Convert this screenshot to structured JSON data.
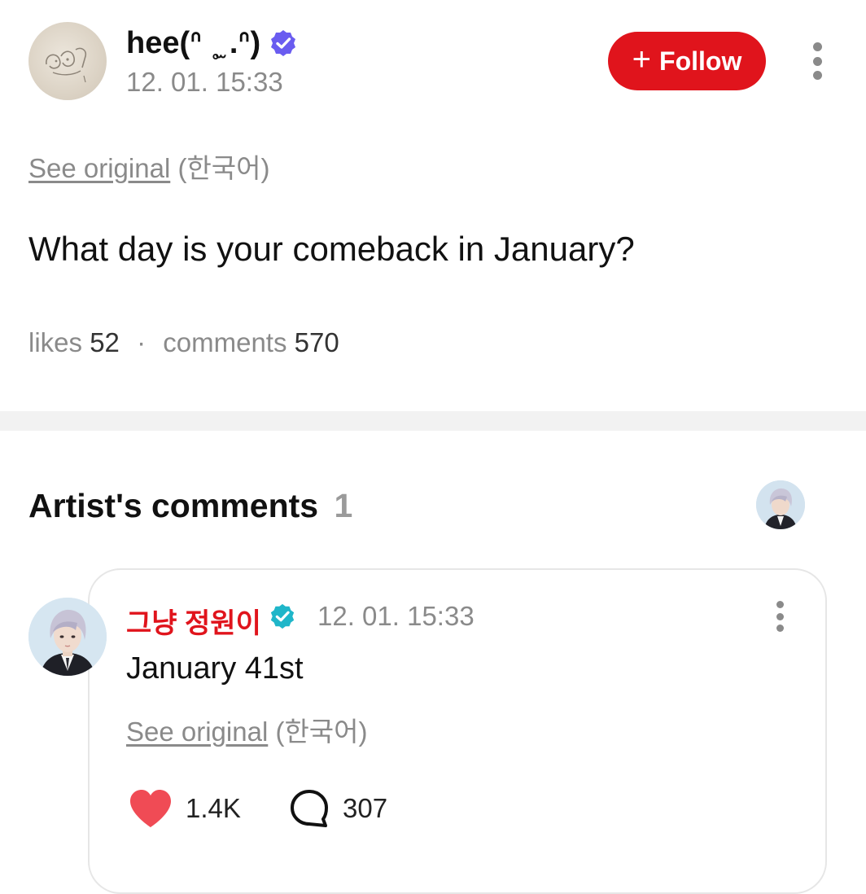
{
  "post": {
    "author_name": "hee(ᐢ ˳̫ .ᐢ)",
    "timestamp": "12. 01. 15:33",
    "follow_label": "Follow",
    "see_original_label": "See original",
    "original_language": "(한국어)",
    "text": "What day is your comeback in January?",
    "likes_label": "likes",
    "likes_count": "52",
    "separator": "·",
    "comments_label": "comments",
    "comments_count": "570"
  },
  "artist_comments": {
    "title": "Artist's comments",
    "count": "1",
    "comment": {
      "author_name": "그냥 정원이",
      "timestamp": "12. 01. 15:33",
      "text": "January 41st",
      "see_original_label": "See original",
      "original_language": "(한국어)",
      "like_count": "1.4K",
      "reply_count": "307"
    }
  },
  "colors": {
    "accent_red": "#e0141c",
    "verified_purple": "#6a5cf0",
    "verified_teal": "#1fb6c9",
    "muted_text": "#8a8a8a",
    "heart": "#f04b55"
  },
  "icons": {
    "verified_user": "verified-badge-icon",
    "verified_artist": "verified-badge-icon",
    "more": "more-vertical-icon",
    "like": "heart-icon",
    "reply": "comment-bubble-icon",
    "plus": "plus-icon"
  }
}
